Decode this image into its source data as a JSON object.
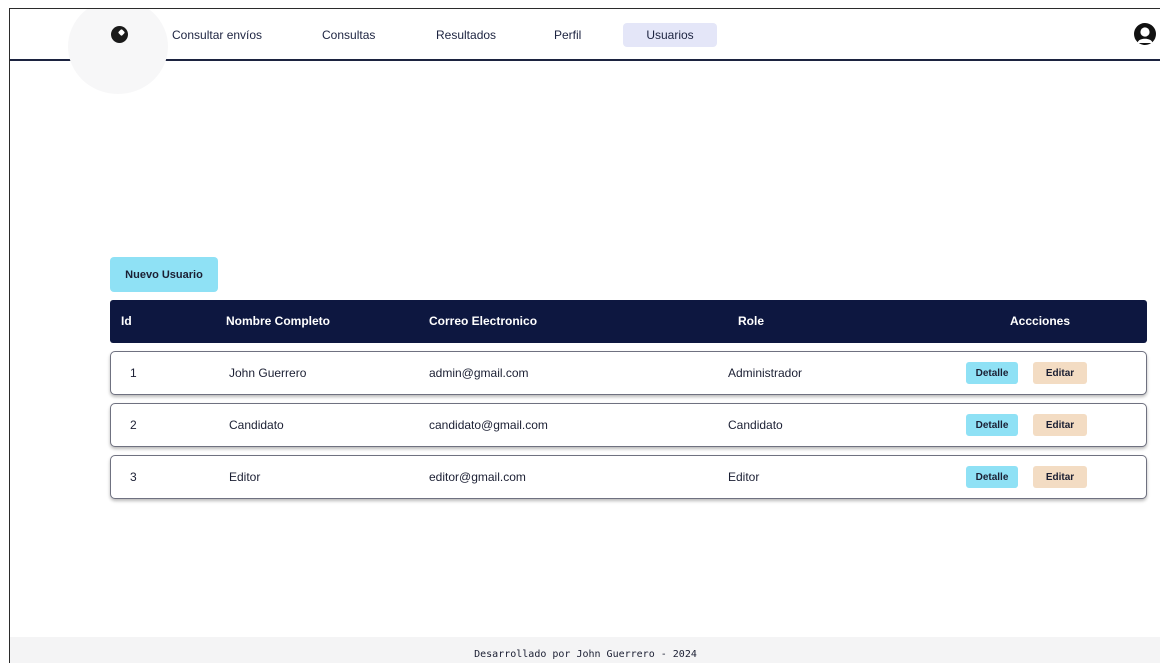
{
  "nav": {
    "items": [
      {
        "label": "Consultar envíos",
        "active": false
      },
      {
        "label": "Consultas",
        "active": false
      },
      {
        "label": "Resultados",
        "active": false
      },
      {
        "label": "Perfil",
        "active": false
      },
      {
        "label": "Usuarios",
        "active": true
      }
    ],
    "logo_icon": "compass-logo-icon",
    "profile_icon": "user-profile-icon"
  },
  "main": {
    "new_user_label": "Nuevo Usuario",
    "table": {
      "columns": [
        "Id",
        "Nombre Completo",
        "Correo Electronico",
        "Role",
        "Accciones"
      ],
      "rows": [
        {
          "id": "1",
          "name": "John Guerrero",
          "email": "admin@gmail.com",
          "role": "Administrador"
        },
        {
          "id": "2",
          "name": "Candidato",
          "email": "candidato@gmail.com",
          "role": "Candidato"
        },
        {
          "id": "3",
          "name": "Editor",
          "email": "editor@gmail.com",
          "role": "Editor"
        }
      ],
      "detail_label": "Detalle",
      "edit_label": "Editar"
    }
  },
  "footer": {
    "text": "Desarrollado por John Guerrero - 2024"
  },
  "colors": {
    "header_border": "#1c2340",
    "table_header_bg": "#0d1740",
    "primary_button": "#8fe1f5",
    "edit_button": "#f3dcc3",
    "active_nav_bg": "#e4e6f8"
  }
}
